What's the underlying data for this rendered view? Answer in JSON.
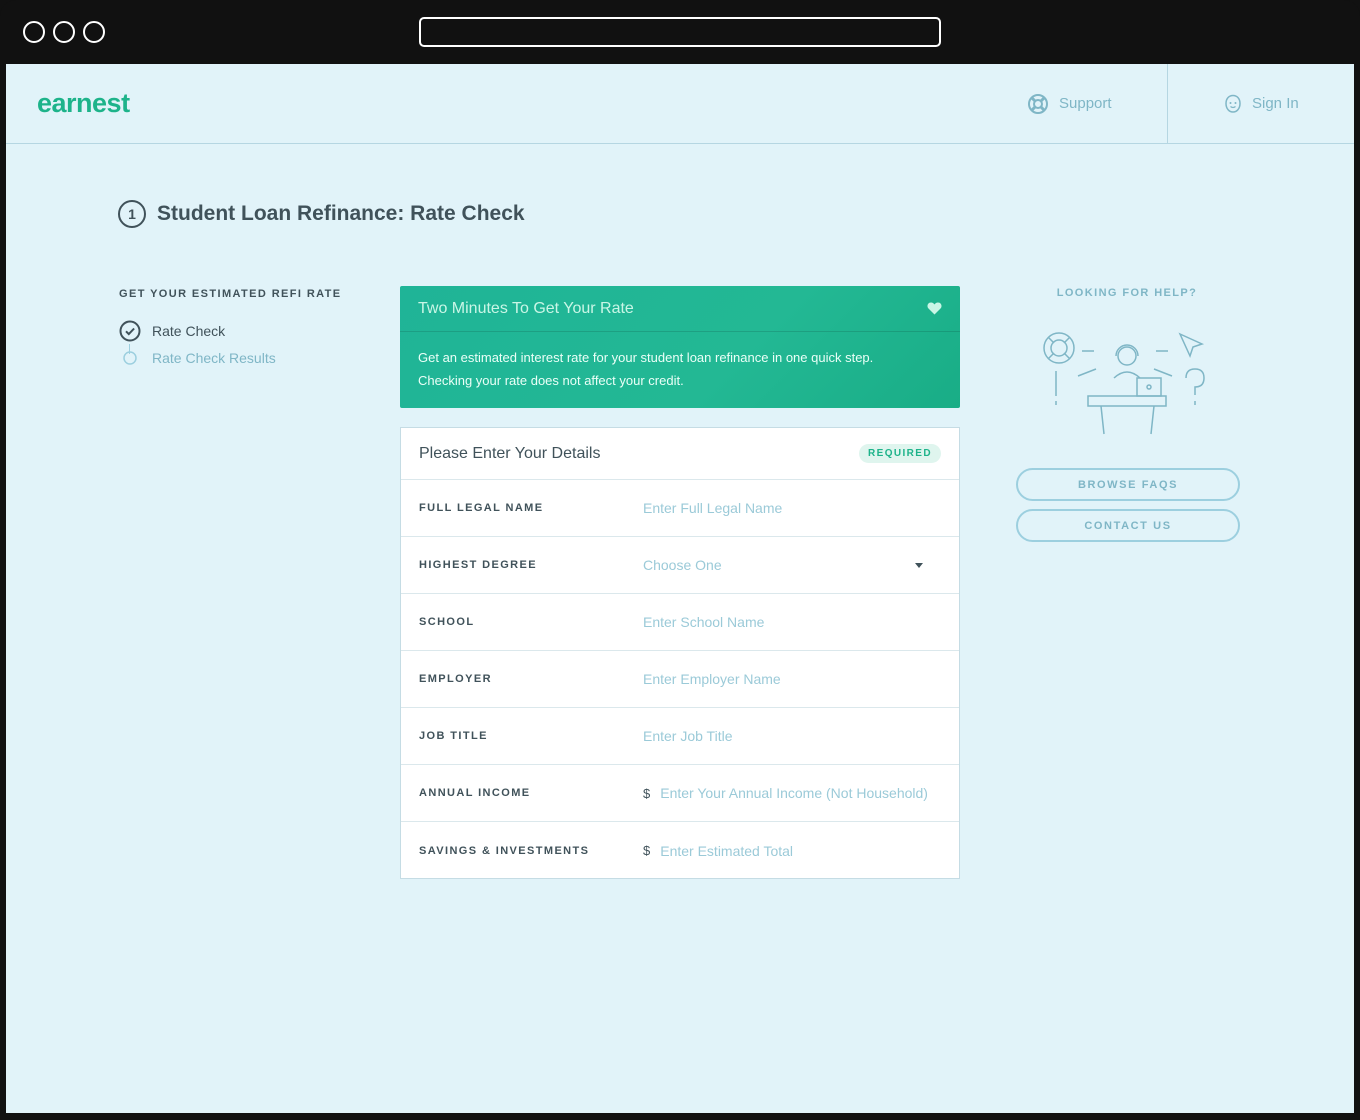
{
  "header": {
    "logo": "earnest",
    "support_label": "Support",
    "signin_label": "Sign In"
  },
  "page": {
    "step_number": "1",
    "title": "Student Loan Refinance: Rate Check"
  },
  "sidebar": {
    "heading": "GET YOUR ESTIMATED REFI RATE",
    "steps": [
      {
        "label": "Rate Check",
        "state": "complete"
      },
      {
        "label": "Rate Check Results",
        "state": "upcoming"
      }
    ]
  },
  "banner": {
    "title": "Two Minutes To Get Your Rate",
    "line1": "Get an estimated interest rate for your student loan refinance in one quick step.",
    "line2": "Checking your rate does not affect your credit."
  },
  "form": {
    "title": "Please Enter Your Details",
    "badge": "REQUIRED",
    "fields": [
      {
        "label": "FULL LEGAL NAME",
        "placeholder": "Enter Full Legal Name"
      },
      {
        "label": "HIGHEST DEGREE",
        "placeholder": "Choose One"
      },
      {
        "label": "SCHOOL",
        "placeholder": "Enter School Name"
      },
      {
        "label": "EMPLOYER",
        "placeholder": "Enter Employer Name"
      },
      {
        "label": "JOB TITLE",
        "placeholder": "Enter Job Title"
      },
      {
        "label": "ANNUAL INCOME",
        "prefix": "$",
        "placeholder": "Enter Your Annual Income (Not Household)"
      },
      {
        "label": "SAVINGS & INVESTMENTS",
        "prefix": "$",
        "placeholder": "Enter Estimated Total"
      }
    ]
  },
  "help": {
    "heading": "LOOKING FOR HELP?",
    "faq_button": "BROWSE FAQS",
    "contact_button": "CONTACT US"
  },
  "colors": {
    "brand": "#1db38a",
    "background": "#e1f3f9",
    "text": "#40525a",
    "muted": "#7fb6c6"
  }
}
